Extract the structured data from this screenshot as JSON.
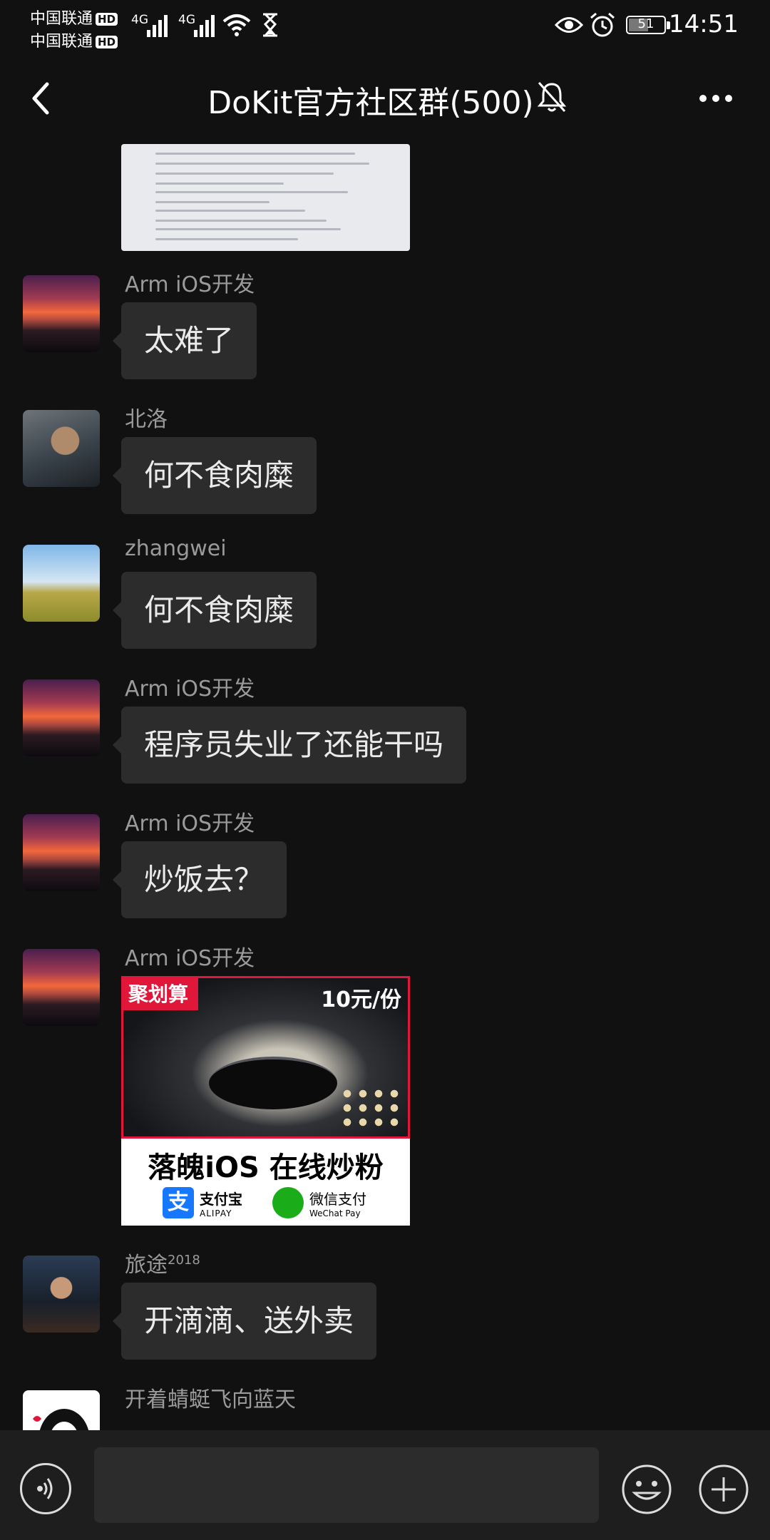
{
  "status_bar": {
    "carrier_1": "中国联通",
    "carrier_2": "中国联通",
    "hd_badge": "HD",
    "network_1": "4G",
    "network_2": "4G",
    "battery_level": "51",
    "time": "14:51"
  },
  "header": {
    "title": "DoKit官方社区群(500)"
  },
  "messages": [
    {
      "sender": "Arm iOS开发",
      "text": "太难了"
    },
    {
      "sender": "北洛",
      "text": "何不食肉糜"
    },
    {
      "sender": "zhangwei",
      "text": "何不食肉糜"
    },
    {
      "sender": "Arm iOS开发",
      "text": "程序员失业了还能干吗"
    },
    {
      "sender": "Arm iOS开发",
      "text": "炒饭去？"
    },
    {
      "sender": "Arm iOS开发",
      "image": {
        "tag": "聚划算",
        "price": "10元/份",
        "caption": "落魄iOS 在线炒粉",
        "alipay_label": "支付宝",
        "alipay_sub": "ALIPAY",
        "wechat_label": "微信支付",
        "wechat_sub": "WeChat Pay"
      }
    },
    {
      "sender": "旅途",
      "sender_sup": "2018",
      "text": "开滴滴、送外卖"
    },
    {
      "sender": "开着蜻蜓飞向蓝天",
      "text": ""
    }
  ],
  "input": {
    "placeholder": ""
  },
  "icons": {
    "back": "chevron-left-icon",
    "mute": "bell-off-icon",
    "more": "more-horizontal-icon",
    "voice": "voice-icon",
    "emoji": "smile-icon",
    "plus": "plus-circle-icon"
  }
}
